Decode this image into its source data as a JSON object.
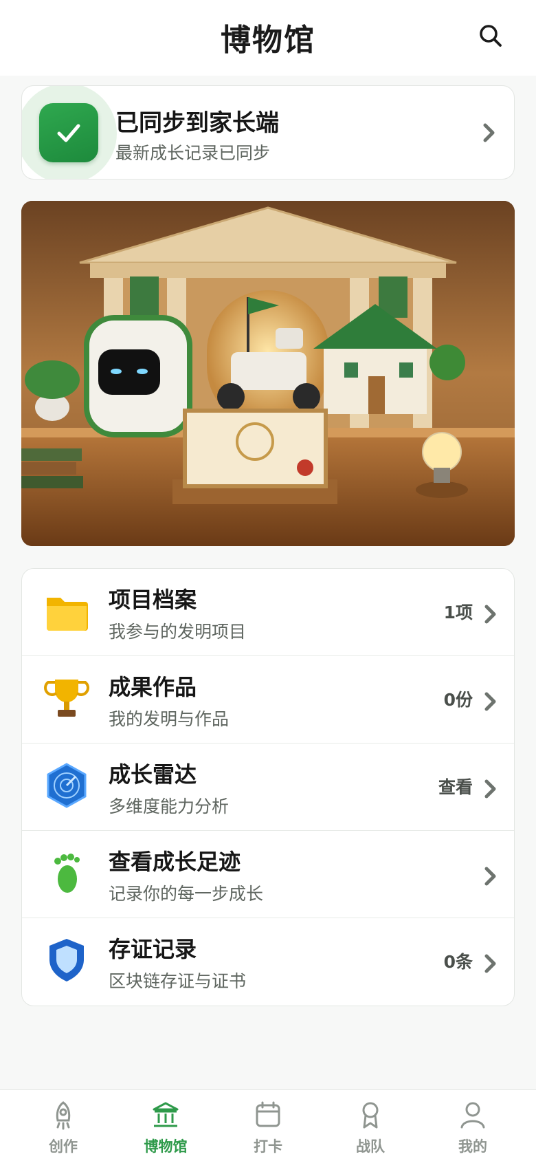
{
  "header": {
    "title": "博物馆",
    "search_icon": "search-icon"
  },
  "sync": {
    "title": "已同步到家长端",
    "subtitle": "最新成长记录已同步",
    "icon": "check-icon",
    "accent": "#2a9d4a"
  },
  "hero": {
    "description_icon": "museum-hero-illustration"
  },
  "list": [
    {
      "title": "项目档案",
      "subtitle": "我参与的发明项目",
      "value": "1项",
      "icon": "folder-icon"
    },
    {
      "title": "成果作品",
      "subtitle": "我的发明与作品",
      "value": "0份",
      "icon": "trophy-icon"
    },
    {
      "title": "成长雷达",
      "subtitle": "多维度能力分析",
      "value": "查看",
      "icon": "radar-icon"
    },
    {
      "title": "查看成长足迹",
      "subtitle": "记录你的每一步成长",
      "value": "",
      "icon": "footprint-icon"
    },
    {
      "title": "存证记录",
      "subtitle": "区块链存证与证书",
      "value": "0条",
      "icon": "shield-icon"
    }
  ],
  "tabs": [
    {
      "label": "创作",
      "icon": "rocket-icon",
      "active": false
    },
    {
      "label": "博物馆",
      "icon": "museum-icon",
      "active": true
    },
    {
      "label": "打卡",
      "icon": "calendar-icon",
      "active": false
    },
    {
      "label": "战队",
      "icon": "badge-icon",
      "active": false
    },
    {
      "label": "我的",
      "icon": "user-icon",
      "active": false
    }
  ],
  "colors": {
    "accent": "#2e9a4a",
    "inactive": "#8f9590",
    "background": "#f7f8f7"
  }
}
